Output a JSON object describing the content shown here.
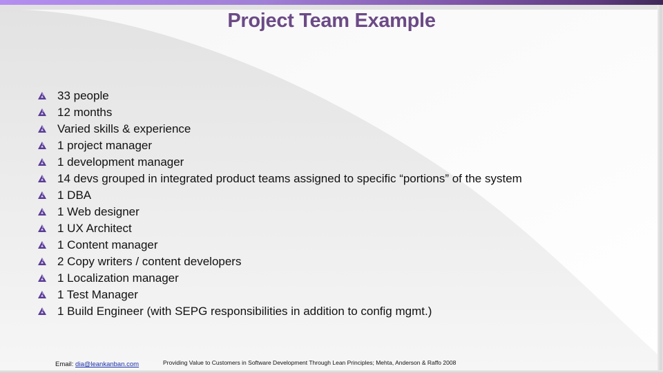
{
  "slide": {
    "title": "Project Team Example",
    "bullets": [
      "33 people",
      "12 months",
      "Varied skills & experience",
      "1 project manager",
      "1 development manager",
      "14 devs grouped in integrated product teams assigned to specific “portions” of the system",
      "1 DBA",
      "1 Web designer",
      "1 UX Architect",
      "1 Content manager",
      "2 Copy writers / content developers",
      "1 Localization manager",
      "1 Test Manager",
      "1 Build Engineer (with SEPG responsibilities in addition to config mgmt.)"
    ],
    "bullet_icon": "triangle-swirl-icon"
  },
  "footer": {
    "email_label": "Email: ",
    "email": "dia@leankanban.com",
    "citation": "Providing Value to Customers in Software Development Through Lean Principles; Mehta, Anderson & Raffo 2008"
  },
  "colors": {
    "title": "#6b4a86",
    "accent_bar_start": "#b48ef0",
    "accent_bar_end": "#3e2858",
    "bullet": "#5a3c96",
    "link": "#1a2fa8"
  }
}
